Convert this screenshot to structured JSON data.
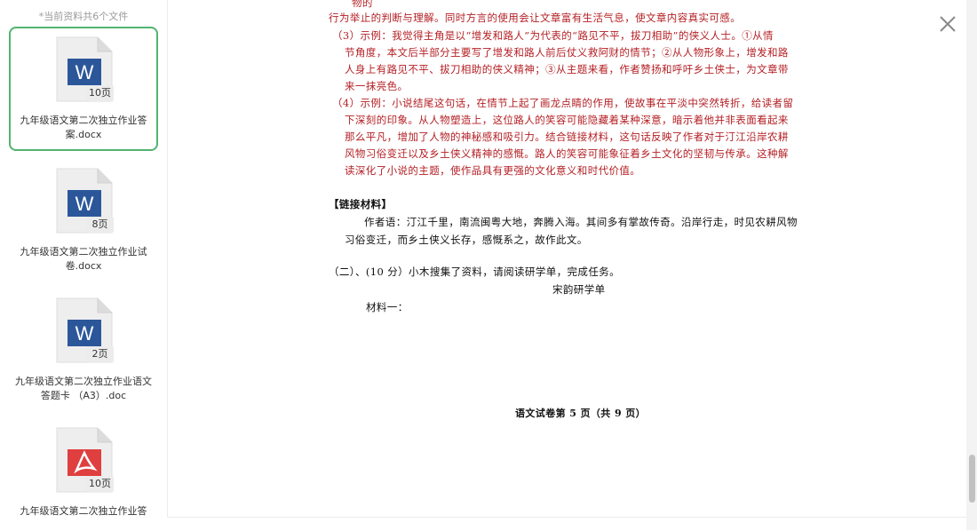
{
  "sidebar": {
    "title": "*当前资料共6个文件",
    "files": [
      {
        "name": "九年级语文第二次独立作业答案.docx",
        "pages": "10页",
        "type": "word"
      },
      {
        "name": "九年级语文第二次独立作业试卷.docx",
        "pages": "8页",
        "type": "word"
      },
      {
        "name": "九年级语文第二次独立作业语文答题卡 （A3）.doc",
        "pages": "2页",
        "type": "word"
      },
      {
        "name": "九年级语文第二次独立作业答",
        "pages": "10页",
        "type": "pdf"
      }
    ]
  },
  "document": {
    "lines": [
      {
        "text": "物的",
        "color": "red"
      },
      {
        "text": "行为举止的判断与理解。同时方言的使用会让文章富有生活气息，使文章内容真实可感。",
        "color": "red"
      },
      {
        "text": "（3）示例：我觉得主角是以“增发和路人”为代表的“路见不平，拔刀相助”的侠义人士。①从情",
        "color": "red"
      },
      {
        "text": "节角度，本文后半部分主要写了增发和路人前后仗义救阿财的情节；②从人物形象上，增发和路",
        "color": "red"
      },
      {
        "text": "人身上有路见不平、拔刀相助的侠义精神；③从主题来看，作者赞扬和呼吁乡土侠士，为文章带",
        "color": "red"
      },
      {
        "text": "来一抹亮色。",
        "color": "red"
      },
      {
        "text": "（4）示例：小说结尾这句话，在情节上起了画龙点睛的作用，使故事在平淡中突然转折，给读者留",
        "color": "red"
      },
      {
        "text": "下深刻的印象。从人物塑造上，这位路人的笑容可能隐藏着某种深意，暗示着他并非表面看起来",
        "color": "red"
      },
      {
        "text": "那么平凡，增加了人物的神秘感和吸引力。结合链接材料，这句话反映了作者对于汀江沿岸农耕",
        "color": "red"
      },
      {
        "text": "风物习俗变迁以及乡土侠义精神的感慨。路人的笑容可能象征着乡土文化的坚韧与传承。这种解",
        "color": "red"
      },
      {
        "text": "读深化了小说的主题，使作品具有更强的文化意义和时代价值。",
        "color": "red"
      },
      {
        "text": "【链接材料】",
        "color": "black"
      },
      {
        "text": "作者语：汀江千里，南流闽粤大地，奔腾入海。其间多有掌故传奇。沿岸行走，时见农耕风物",
        "color": "black"
      },
      {
        "text": "习俗变迁，而乡土侠义长存，感慨系之，故作此文。",
        "color": "black"
      },
      {
        "text": "（二）、(10 分）小木搜集了资料，请阅读研学单，完成任务。",
        "color": "black"
      },
      {
        "text": "宋韵研学单",
        "color": "black"
      },
      {
        "text": "材料一：",
        "color": "black"
      },
      {
        "text": "语文试卷第 5 页（共 9 页）",
        "color": "black"
      }
    ]
  },
  "colors": {
    "accent_green": "#52b46f",
    "answer_red": "#b42025",
    "word_blue": "#2b579a",
    "pdf_red": "#e03f3f"
  },
  "icons": {
    "close": "close-icon",
    "word": "word-doc-icon",
    "pdf": "pdf-doc-icon"
  }
}
